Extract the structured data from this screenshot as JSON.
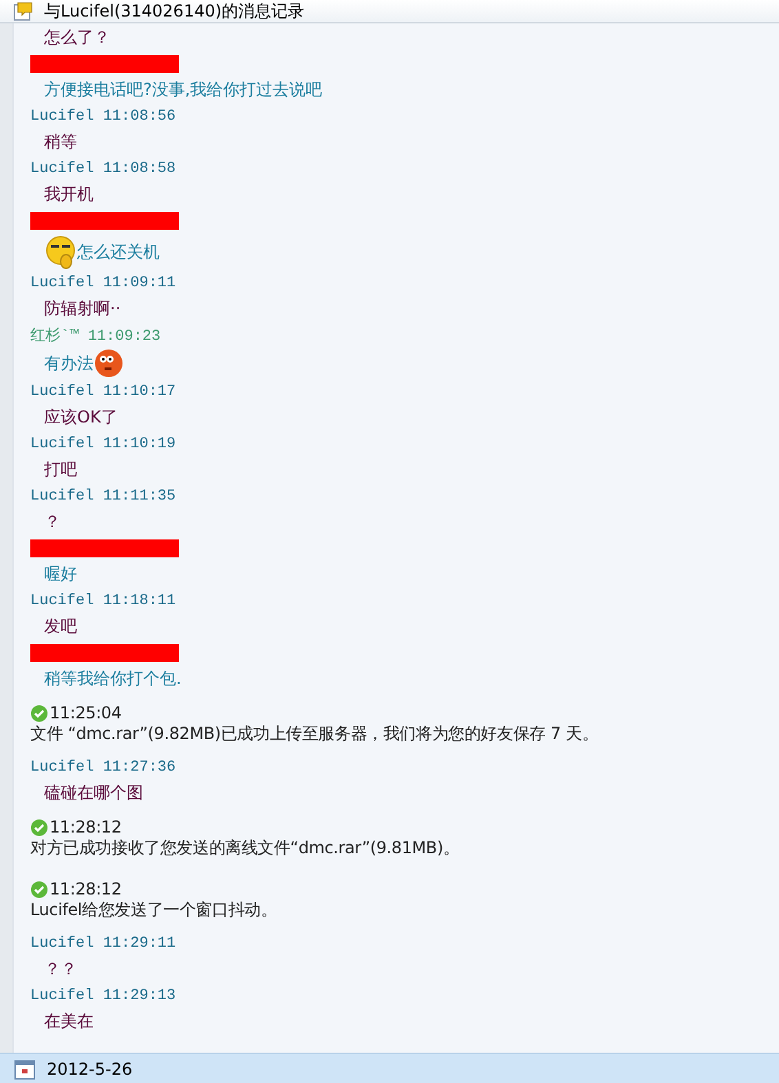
{
  "window": {
    "title": "与Lucifel(314026140)的消息记录"
  },
  "entries": [
    {
      "kind": "message",
      "color": "#5a0a3a",
      "text": "怎么了？"
    },
    {
      "kind": "redacted"
    },
    {
      "kind": "message",
      "color": "#1a7d9e",
      "text": "方便接电话吧?没事,我给你打过去说吧"
    },
    {
      "kind": "header",
      "color": "#1a6a8a",
      "sender": "Lucifel",
      "time": "11:08:56"
    },
    {
      "kind": "message",
      "color": "#5a0a3a",
      "text": "稍等"
    },
    {
      "kind": "header",
      "color": "#1a6a8a",
      "sender": "Lucifel",
      "time": "11:08:58"
    },
    {
      "kind": "message",
      "color": "#5a0a3a",
      "text": "我开机"
    },
    {
      "kind": "redacted"
    },
    {
      "kind": "message",
      "color": "#1a7d9e",
      "text": "怎么还关机",
      "emoticon_before": true
    },
    {
      "kind": "header",
      "color": "#1a6a8a",
      "sender": "Lucifel",
      "time": "11:09:11"
    },
    {
      "kind": "message",
      "color": "#5a0a3a",
      "text": "防辐射啊··"
    },
    {
      "kind": "header",
      "color": "#3d9a6e",
      "sender": "红杉`™",
      "time": "11:09:23"
    },
    {
      "kind": "message",
      "color": "#1a7d9e",
      "text": "有办法",
      "emoticon_after": true
    },
    {
      "kind": "header",
      "color": "#1a6a8a",
      "sender": "Lucifel",
      "time": "11:10:17"
    },
    {
      "kind": "message",
      "color": "#5a0a3a",
      "text": "应该OK了"
    },
    {
      "kind": "header",
      "color": "#1a6a8a",
      "sender": "Lucifel",
      "time": "11:10:19"
    },
    {
      "kind": "message",
      "color": "#5a0a3a",
      "text": "打吧"
    },
    {
      "kind": "header",
      "color": "#1a6a8a",
      "sender": "Lucifel",
      "time": "11:11:35"
    },
    {
      "kind": "message",
      "color": "#5a0a3a",
      "text": "？"
    },
    {
      "kind": "redacted"
    },
    {
      "kind": "message",
      "color": "#1a7d9e",
      "text": "喔好"
    },
    {
      "kind": "header",
      "color": "#1a6a8a",
      "sender": "Lucifel",
      "time": "11:18:11"
    },
    {
      "kind": "message",
      "color": "#5a0a3a",
      "text": "发吧"
    },
    {
      "kind": "redacted"
    },
    {
      "kind": "message",
      "color": "#1a7d9e",
      "text": "稍等我给你打个包."
    },
    {
      "kind": "system",
      "time": "11:25:04",
      "text": "文件 “dmc.rar”(9.82MB)已成功上传至服务器，我们将为您的好友保存 7 天。"
    },
    {
      "kind": "header",
      "color": "#1a6a8a",
      "sender": "Lucifel",
      "time": "11:27:36"
    },
    {
      "kind": "message",
      "color": "#5a0a3a",
      "text": "磕碰在哪个图"
    },
    {
      "kind": "system",
      "time": "11:28:12",
      "text": "对方已成功接收了您发送的离线文件“dmc.rar”(9.81MB)。"
    },
    {
      "kind": "system",
      "time": "11:28:12",
      "text": "Lucifel给您发送了一个窗口抖动。"
    },
    {
      "kind": "header",
      "color": "#1a6a8a",
      "sender": "Lucifel",
      "time": "11:29:11"
    },
    {
      "kind": "message",
      "color": "#5a0a3a",
      "text": "？？"
    },
    {
      "kind": "header",
      "color": "#1a6a8a",
      "sender": "Lucifel",
      "time": "11:29:13"
    },
    {
      "kind": "message",
      "color": "#5a0a3a",
      "text": "在美在"
    }
  ],
  "footer": {
    "date": "2012-5-26"
  }
}
